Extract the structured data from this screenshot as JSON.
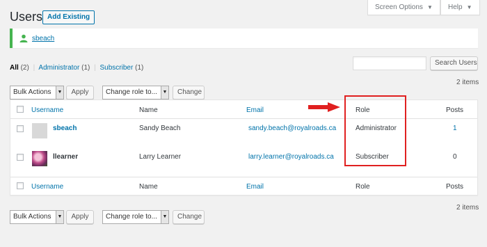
{
  "page": {
    "title": "Users",
    "add_existing_label": "Add Existing"
  },
  "screen_options": {
    "label": "Screen Options",
    "help_label": "Help"
  },
  "notice": {
    "username": "sbeach",
    "icon": "user-icon"
  },
  "filters": {
    "all": "All",
    "all_count": "(2)",
    "administrator": "Administrator",
    "administrator_count": "(1)",
    "subscriber": "Subscriber",
    "subscriber_count": "(1)"
  },
  "search": {
    "value": "",
    "button_label": "Search Users"
  },
  "top_actions": {
    "bulk_select": "Bulk Actions",
    "apply_label": "Apply",
    "role_select": "Change role to...",
    "change_label": "Change"
  },
  "bottom_actions": {
    "bulk_select": "Bulk Actions",
    "apply_label": "Apply",
    "role_select": "Change role to...",
    "change_label": "Change"
  },
  "item_count_top": "2 items",
  "item_count_bottom": "2 items",
  "columns": {
    "username": "Username",
    "name": "Name",
    "email": "Email",
    "role": "Role",
    "posts": "Posts"
  },
  "rows": [
    {
      "username": "sbeach",
      "name": "Sandy Beach",
      "email": "sandy.beach@royalroads.ca",
      "role": "Administrator",
      "posts": "1"
    },
    {
      "username": "llearner",
      "name": "Larry Learner",
      "email": "larry.learner@royalroads.ca",
      "role": "Subscriber",
      "posts": "0"
    }
  ],
  "annotation": {
    "arrow_color": "#e02020",
    "box_color": "#e02020"
  }
}
